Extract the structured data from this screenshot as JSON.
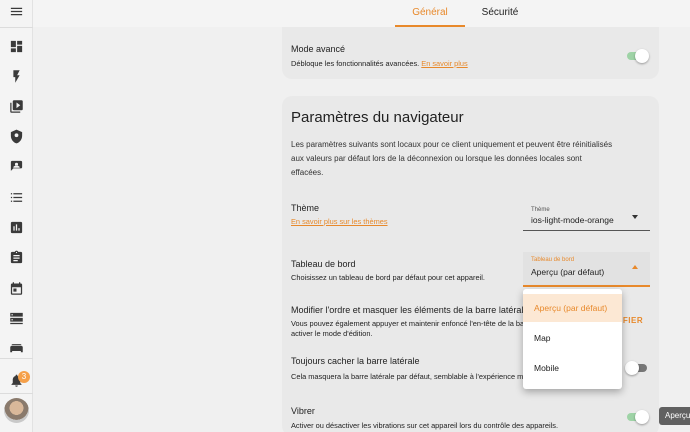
{
  "tabs": [
    {
      "label": "Général",
      "active": true
    },
    {
      "label": "Sécurité",
      "active": false
    }
  ],
  "sidebar": {
    "items": [
      "menu-icon",
      "dashboard-icon",
      "lightning-icon",
      "media-icon",
      "shield-icon",
      "account-box-icon",
      "list-icon",
      "chart-icon",
      "clipboard-icon",
      "calendar-icon",
      "server-icon",
      "sofa-icon"
    ],
    "notification_count": "3"
  },
  "advanced_mode": {
    "title": "Mode avancé",
    "desc": "Débloque les fonctionnalités avancées.",
    "link": "En savoir plus",
    "enabled": true
  },
  "browser": {
    "heading": "Paramètres du navigateur",
    "intro_lines": [
      "Les paramètres suivants sont locaux pour ce client uniquement et peuvent être réinitialisés",
      "aux valeurs par défaut lors de la déconnexion ou lorsque les données locales sont",
      "effacées."
    ],
    "theme": {
      "title": "Thème",
      "link": "En savoir plus sur les thèmes",
      "select_label": "Thème",
      "select_value": "ios-light-mode-orange"
    },
    "dashboard": {
      "title": "Tableau de bord",
      "desc": "Choisissez un tableau de bord par défaut pour cet appareil.",
      "select_label": "Tableau de bord",
      "select_value": "Aperçu (par défaut)",
      "options": [
        "Aperçu (par défaut)",
        "Map",
        "Mobile"
      ]
    },
    "sidebar_order": {
      "title": "Modifier l'ordre et masquer les éléments de la barre latérale",
      "desc_lines": [
        "Vous pouvez également appuyer et maintenir enfoncé l'en-tête de la barre latérale pour",
        "activer le mode d'édition."
      ],
      "action": "MODIFIER"
    },
    "always_hide": {
      "title": "Toujours cacher la barre latérale",
      "desc": "Cela masquera la barre latérale par défaut, semblable à l'expérience mobile.",
      "enabled": false
    },
    "vibrate": {
      "title": "Vibrer",
      "desc": "Activer ou désactiver les vibrations sur cet appareil lors du contrôle des appareils.",
      "enabled": true
    }
  },
  "tooltip": "Aperçu"
}
